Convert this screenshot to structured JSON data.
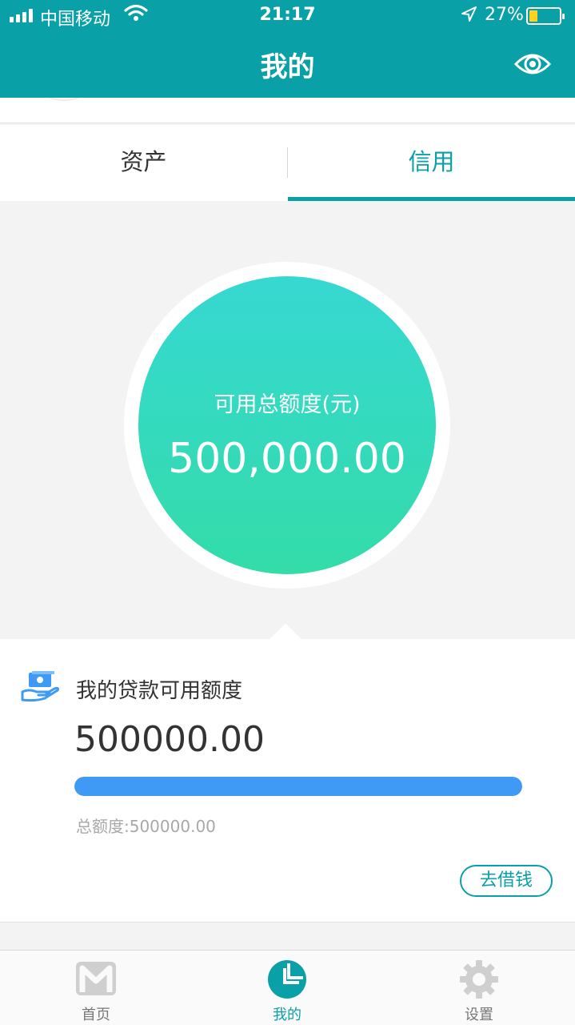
{
  "status_bar": {
    "carrier": "中国移动",
    "time": "21:17",
    "battery_text": "27%",
    "battery_level": 0.27
  },
  "header": {
    "title": "我的",
    "icon": "eye-icon"
  },
  "tabs": [
    {
      "label": "资产",
      "active": false
    },
    {
      "label": "信用",
      "active": true
    }
  ],
  "credit_circle": {
    "label": "可用总额度(元)",
    "amount": "500,000.00"
  },
  "loan_card": {
    "icon": "money-hand-icon",
    "title": "我的贷款可用额度",
    "amount": "500000.00",
    "progress": 1.0,
    "total_text": "总额度:500000.00",
    "button_label": "去借钱"
  },
  "bottom_nav": [
    {
      "label": "首页",
      "icon": "home-m-icon",
      "active": false
    },
    {
      "label": "我的",
      "icon": "pie-chart-icon",
      "active": true
    },
    {
      "label": "设置",
      "icon": "gear-icon",
      "active": false
    }
  ],
  "colors": {
    "primary": "#0aa0a7",
    "circle_top": "#36d8d2",
    "circle_bottom": "#33dca8",
    "progress": "#3f9af6",
    "battery": "#ffd21f"
  }
}
